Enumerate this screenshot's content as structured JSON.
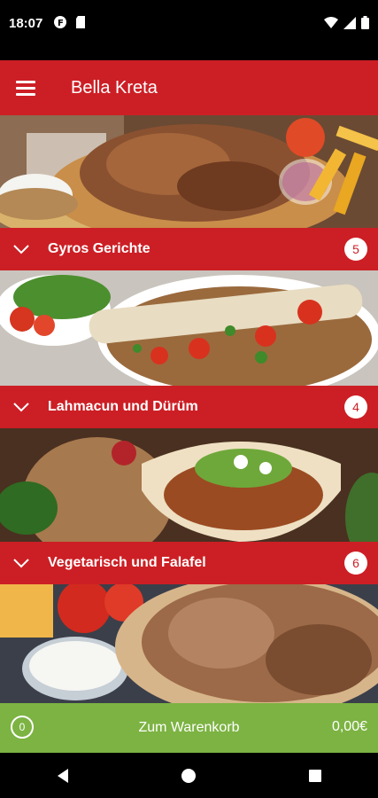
{
  "status_bar": {
    "time": "18:07"
  },
  "app_bar": {
    "title": "Bella Kreta"
  },
  "categories": [
    {
      "label": "Gyros Gerichte",
      "count": "5"
    },
    {
      "label": "Lahmacun und Dürüm",
      "count": "4"
    },
    {
      "label": "Vegetarisch und Falafel",
      "count": "6"
    }
  ],
  "cart": {
    "count": "0",
    "label": "Zum Warenkorb",
    "total": "0,00€"
  },
  "colors": {
    "accent": "#cc1f25",
    "cart": "#7cb342"
  }
}
